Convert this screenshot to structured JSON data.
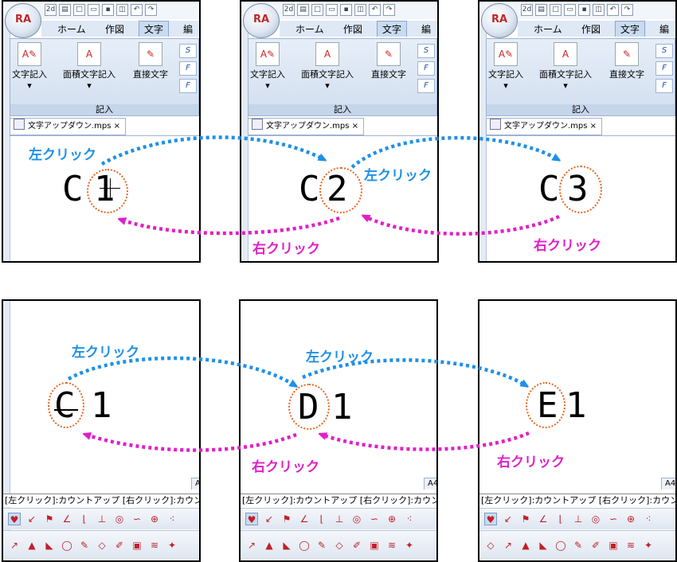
{
  "colors": {
    "left_click": "#1e90e8",
    "right_click": "#e020c8",
    "circle": "#e8641e"
  },
  "ribbon": {
    "tabs": [
      "ホーム",
      "作図",
      "文字",
      "編"
    ],
    "buttons": [
      "文字記入",
      "面積文字記入",
      "直接文字"
    ],
    "group_label": "記入",
    "doc_tab": "文字アップダウン.mps",
    "doc_tab_close": "×",
    "small_icons": [
      "S",
      "F",
      "F"
    ]
  },
  "labels": {
    "left": "左クリック",
    "right": "右クリック"
  },
  "top": {
    "panel1": {
      "prefix": "C",
      "value": "1"
    },
    "panel2": {
      "prefix": "C",
      "value": "2"
    },
    "panel3": {
      "prefix": "C",
      "value": "3"
    }
  },
  "bottom": {
    "panel1": {
      "value": "C",
      "suffix": "1"
    },
    "panel2": {
      "value": "D",
      "suffix": "1"
    },
    "panel3": {
      "value": "E",
      "suffix": "1"
    },
    "a4_label": "A4",
    "status_text": "[左クリック]:カウントアップ [右クリック]:カウントダウン"
  },
  "toolbar_icons": [
    "heart-icon",
    "pin-icon",
    "flag-icon",
    "angle-icon",
    "corner-icon",
    "point-icon",
    "target-icon",
    "curve-icon",
    "crosshair-icon",
    "dots-icon"
  ],
  "toolbar2_icons": [
    "a-icon",
    "b-icon",
    "c-icon",
    "d-icon",
    "e-icon",
    "f-icon",
    "g-icon",
    "h-icon",
    "i-icon",
    "j-icon"
  ]
}
